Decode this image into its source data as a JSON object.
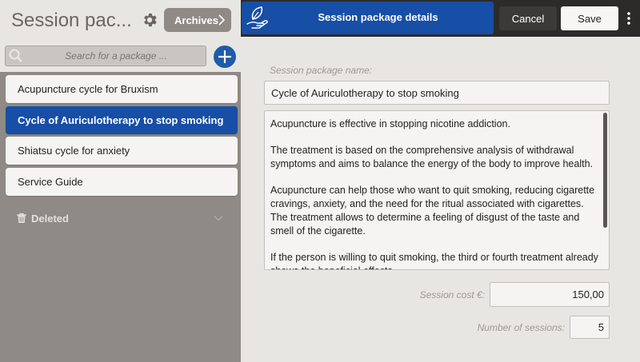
{
  "sidebar": {
    "title": "Session pac...",
    "archives_label": "Archives",
    "search_placeholder": "Search for a package ...",
    "items": [
      {
        "label": "Acupuncture cycle for Bruxism"
      },
      {
        "label": "Cycle of Auriculotherapy to stop smoking"
      },
      {
        "label": "Shiatsu cycle for anxiety"
      },
      {
        "label": "Service Guide"
      }
    ],
    "deleted_label": "Deleted"
  },
  "header": {
    "title": "Session package details",
    "cancel_label": "Cancel",
    "save_label": "Save"
  },
  "form": {
    "name_label": "Session package name:",
    "name_value": "Cycle of Auriculotherapy to stop smoking",
    "description_paragraphs": [
      "Acupuncture is effective in stopping nicotine addiction.",
      "The treatment is based on the comprehensive analysis of withdrawal symptoms and aims to balance the energy of the body to improve health.",
      "Acupuncture can help those who want to quit smoking, reducing cigarette cravings, anxiety, and the need for the ritual associated with cigarettes. The treatment allows to determine a feeling of disgust of the taste and smell of the cigarette.",
      "If the person is willing to quit smoking, the third or fourth treatment already shows the beneficial effects."
    ],
    "cost_label": "Session cost €:",
    "cost_value": "150,00",
    "sessions_label": "Number of sessions:",
    "sessions_value": "5"
  },
  "colors": {
    "accent": "#174ea6",
    "sidebar_bg": "#8f8a85",
    "topbar_bg": "#2d2b2a",
    "page_bg": "#e8e6e3"
  },
  "icons": {
    "settings": "gear-icon",
    "archives": "chevron-right-icon",
    "search": "search-icon",
    "add": "plus-icon",
    "deleted": "trash-icon",
    "expand": "chevron-down-icon",
    "logo": "leaf-hand-icon",
    "menu": "kebab-menu-icon"
  }
}
